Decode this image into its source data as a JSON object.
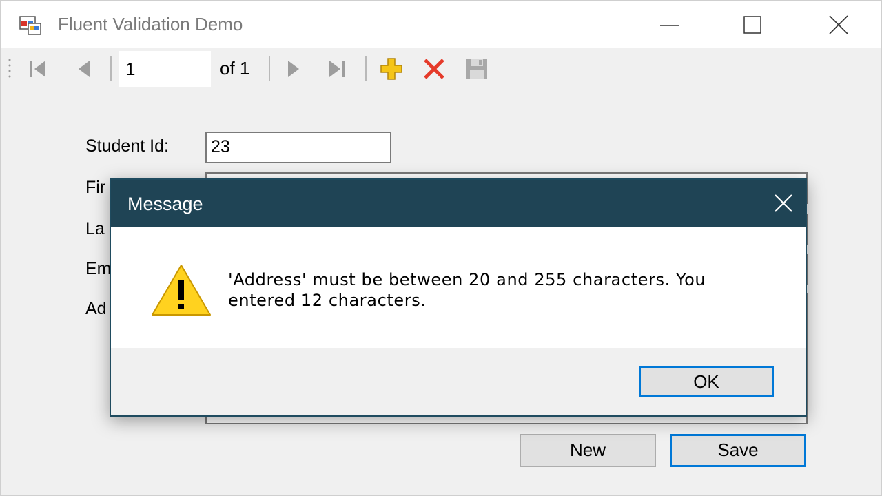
{
  "window": {
    "title": "Fluent Validation Demo"
  },
  "navigator": {
    "position": "1",
    "count_label": "of 1"
  },
  "form": {
    "student_id_label": "Student Id:",
    "student_id_value": "23",
    "first_name_label_partial": "Fir",
    "last_name_label_partial": "La",
    "email_label_partial": "Em",
    "address_label_partial": "Ad",
    "new_button": "New",
    "save_button": "Save"
  },
  "dialog": {
    "title": "Message",
    "message": "'Address' must be between 20 and 255 characters. You entered 12 characters.",
    "ok_button": "OK",
    "icon": "warning-icon"
  },
  "colors": {
    "dialog_title_bg": "#1f4455",
    "focus_accent": "#0078d7",
    "warning_fill": "#ffd21f"
  }
}
